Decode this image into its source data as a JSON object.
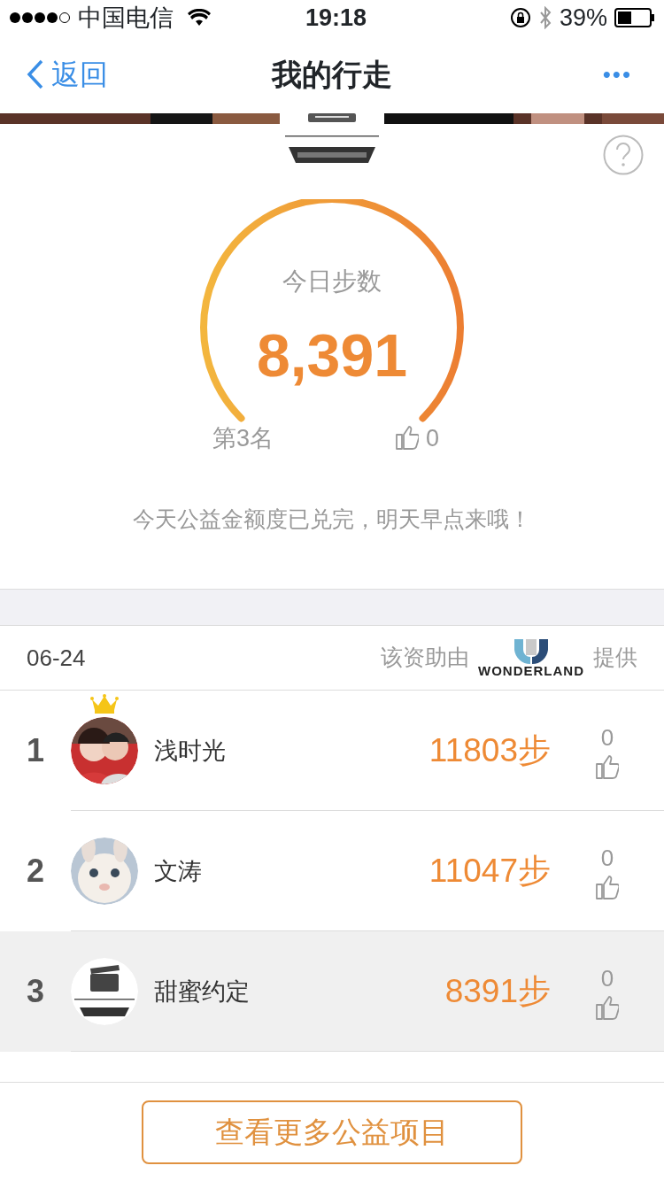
{
  "status_bar": {
    "carrier": "中国电信",
    "time": "19:18",
    "battery": "39%"
  },
  "nav": {
    "back": "返回",
    "title": "我的行走",
    "more": "•••"
  },
  "summary": {
    "label": "今日步数",
    "steps": "8,391",
    "rank": "第3名",
    "likes": "0",
    "message": "今天公益金额度已兑完，明天早点来哦！"
  },
  "sponsor": {
    "date": "06-24",
    "prefix": "该资助由",
    "logo_text": "WONDERLAND",
    "suffix": "提供"
  },
  "ranking": [
    {
      "rank": "1",
      "name": "浅时光",
      "steps": "11803步",
      "likes": "0",
      "crown": true,
      "is_self": false
    },
    {
      "rank": "2",
      "name": "文涛",
      "steps": "11047步",
      "likes": "0",
      "crown": false,
      "is_self": false
    },
    {
      "rank": "3",
      "name": "甜蜜约定",
      "steps": "8391步",
      "likes": "0",
      "crown": false,
      "is_self": true
    }
  ],
  "footer": {
    "button": "查看更多公益项目"
  }
}
